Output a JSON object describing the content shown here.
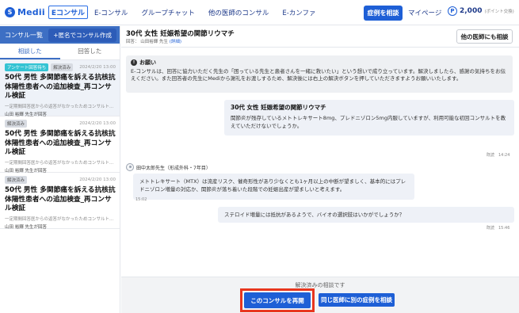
{
  "header": {
    "logo_mark": "S",
    "logo_text": "Medii",
    "logo_sub": "Eコンサル",
    "nav": [
      "E-コンサル",
      "グループチャット",
      "他の医師のコンサル",
      "E-カンファ"
    ],
    "cta_label": "症例を相談",
    "mypage_label": "マイページ",
    "points_icon": "P",
    "points_value": "2,000",
    "points_note": "(ポイント交換)"
  },
  "sidebar": {
    "title": "コンサル一覧",
    "new_button": "+匿名でコンサル作成",
    "tabs": [
      "相談した",
      "回答した"
    ],
    "cases": [
      {
        "badges": [
          "アンケート回答待ち",
          "解決済み"
        ],
        "date": "2024/2/20 13:00",
        "title": "50代 男性 多関節痛を訴える抗核抗体陽性患者への追加検査_再コンサル検証",
        "snippet": "一定期間回答医からの返答がなかったためコンサルト...",
        "doctor": "山田 裕輝 先生が回答"
      },
      {
        "badges": [
          "解決済み"
        ],
        "date": "2024/2/20 13:00",
        "title": "50代 男性 多関節痛を訴える抗核抗体陽性患者への追加検査_再コンサル検証",
        "snippet": "一定期間回答医からの返答がなかったためコンサルト...",
        "doctor": "山田 裕輝 先生が回答"
      },
      {
        "badges": [
          "解決済み"
        ],
        "date": "2024/2/20 13:00",
        "title": "50代 男性 多関節痛を訴える抗核抗体陽性患者への追加検査_再コンサル検証",
        "snippet": "一定期間回答医からの返答がなかったためコンサルト...",
        "doctor": "山田 裕輝 先生が回答"
      }
    ]
  },
  "main": {
    "title": "30代 女性 妊娠希望の関節リウマチ",
    "meta_prefix": "回答：",
    "meta_doctor": "山田裕輝 先生",
    "meta_link": "(詳細)",
    "others_button": "他の医師にも相談"
  },
  "notice": {
    "icon": "!",
    "title": "お願い",
    "body": "E-コンサルは、回答に協力いただく先生の「困っている先生と患者さんを一緒に救いたい」という想いで成り立っています。解決しましたら、感謝の気持ちをお伝えください。また回答者の先生にMediから謝礼をお渡しするため、解決後には右上の解決ボタンを押していただきますようお願いいたします。"
  },
  "messages": {
    "m1": {
      "title": "30代 女性 妊娠希望の関節リウマチ",
      "body": "関節炎が残存しているメトトレキサート8mg、プレドニゾロン5mg内服していますが、利用可能な初回コンサルトを教えていただけないでしょうか。",
      "time": "既読　14:24"
    },
    "m2": {
      "sender": "田中太郎先生（形成外科・7年目）",
      "body": "メトトレキサート（MTX）は流産リスク、催奇形性があり少なくとも1ヶ月以上の中断が望ましく、基本的にはプレドニゾロン増量の対応か、関節炎が落ち着いた段階での妊娠出産が望ましいと考えます。",
      "time": "15:02"
    },
    "m3": {
      "body": "ステロイド増量には抵抗があるようで、バイオの選択肢はいかがでしょうか？",
      "time": "既読　15:46"
    }
  },
  "footer": {
    "note": "解決済みの相談です",
    "reopen_button": "このコンサルを再開",
    "another_button": "同じ医師に別の症例を相談"
  }
}
